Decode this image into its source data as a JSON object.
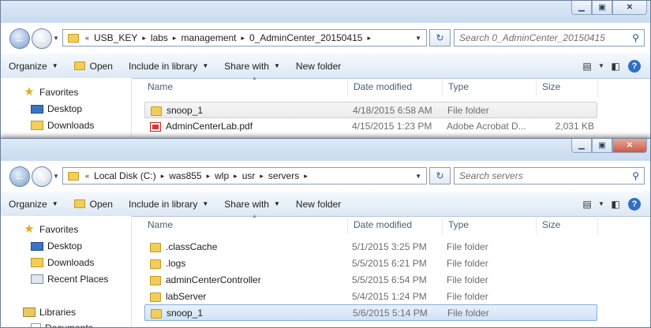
{
  "window_back": {
    "breadcrumb": [
      "USB_KEY",
      "labs",
      "management",
      "0_AdminCenter_20150415"
    ],
    "search_placeholder": "Search 0_AdminCenter_20150415",
    "toolbar": {
      "organize": "Organize",
      "open": "Open",
      "include": "Include in library",
      "share": "Share with",
      "new_folder": "New folder"
    },
    "nav": [
      {
        "label": "Favorites",
        "icon": "star-icon"
      },
      {
        "label": "Desktop",
        "icon": "desktop-icon"
      },
      {
        "label": "Downloads",
        "icon": "downloads-icon"
      }
    ],
    "columns": {
      "name": "Name",
      "date": "Date modified",
      "type": "Type",
      "size": "Size"
    },
    "files": [
      {
        "name": "snoop_1",
        "date": "4/18/2015 6:58 AM",
        "type": "File folder",
        "size": "",
        "icon": "folder-icon"
      },
      {
        "name": "AdminCenterLab.pdf",
        "date": "4/15/2015 1:23 PM",
        "type": "Adobe Acrobat D...",
        "size": "2,031 KB",
        "icon": "pdf-icon"
      }
    ]
  },
  "window_front": {
    "breadcrumb": [
      "Local Disk (C:)",
      "was855",
      "wlp",
      "usr",
      "servers"
    ],
    "search_placeholder": "Search servers",
    "toolbar": {
      "organize": "Organize",
      "open": "Open",
      "include": "Include in library",
      "share": "Share with",
      "new_folder": "New folder"
    },
    "nav": [
      {
        "label": "Favorites",
        "icon": "star-icon"
      },
      {
        "label": "Desktop",
        "icon": "desktop-icon"
      },
      {
        "label": "Downloads",
        "icon": "downloads-icon"
      },
      {
        "label": "Recent Places",
        "icon": "recent-places-icon"
      },
      {
        "label": "Libraries",
        "icon": "libraries-icon"
      },
      {
        "label": "Documents",
        "icon": "documents-icon"
      }
    ],
    "columns": {
      "name": "Name",
      "date": "Date modified",
      "type": "Type",
      "size": "Size"
    },
    "files": [
      {
        "name": ".classCache",
        "date": "5/1/2015 3:25 PM",
        "type": "File folder",
        "icon": "folder-icon"
      },
      {
        "name": ".logs",
        "date": "5/5/2015 6:21 PM",
        "type": "File folder",
        "icon": "folder-icon"
      },
      {
        "name": "adminCenterController",
        "date": "5/5/2015 6:54 PM",
        "type": "File folder",
        "icon": "folder-icon"
      },
      {
        "name": "labServer",
        "date": "5/4/2015 1:24 PM",
        "type": "File folder",
        "icon": "folder-icon"
      },
      {
        "name": "snoop_1",
        "date": "5/6/2015 5:14 PM",
        "type": "File folder",
        "icon": "folder-icon"
      }
    ]
  },
  "colors": {
    "selection": "#cfe2f8",
    "selection_border": "#84acdd",
    "toolbar_top": "#f5f9fd",
    "toolbar_bottom": "#dde8f4",
    "close_button": "#c95a46"
  }
}
